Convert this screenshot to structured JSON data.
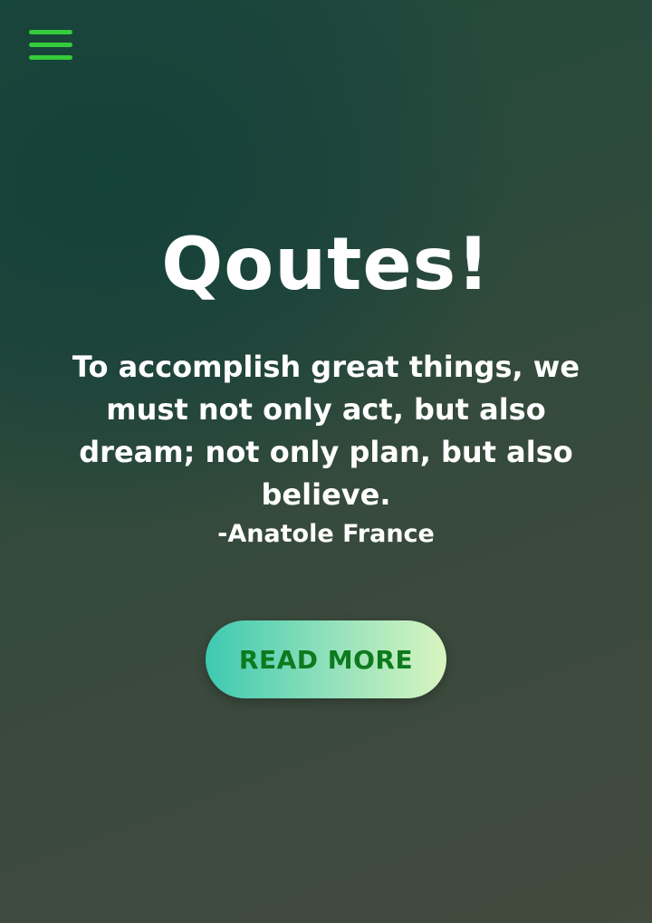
{
  "header": {
    "menu_icon": "hamburger-menu-icon",
    "menu_color": "#33cc3a"
  },
  "main": {
    "title": "Qoutes!",
    "quote": "To accomplish great things, we must not only act, but also dream; not only plan, but also believe.",
    "author": "-Anatole France",
    "read_more_label": "READ MORE"
  },
  "colors": {
    "button_text": "#0e7a1e",
    "button_gradient_start": "#3ec9b1",
    "button_gradient_end": "#d9f5c0"
  }
}
